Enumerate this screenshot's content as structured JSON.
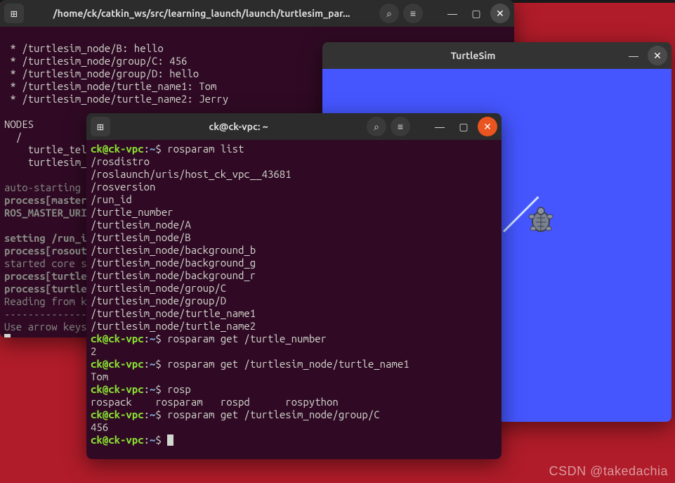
{
  "watermark": "CSDN @takedachia",
  "win1": {
    "title": "/home/ck/catkin_ws/src/learning_launch/launch/turtlesim_par...",
    "lines": [
      " * /turtlesim_node/B: hello",
      " * /turtlesim_node/group/C: 456",
      " * /turtlesim_node/group/D: hello",
      " * /turtlesim_node/turtle_name1: Tom",
      " * /turtlesim_node/turtle_name2: Jerry",
      "",
      "NODES",
      "  /",
      "    turtle_tel",
      "    turtlesim_"
    ],
    "dimlines": [
      "",
      "auto-starting ",
      "process[master",
      "ROS_MASTER_URI",
      "",
      "setting /run_i",
      "process[rosout",
      "started core s",
      "process[turtle",
      "process[turtle",
      "Reading from k",
      "--------------",
      "Use arrow keys"
    ]
  },
  "win2": {
    "title": "ck@ck-vpc: ~",
    "prompt_user": "ck@ck-vpc",
    "prompt_path": "~",
    "prompt_sep": ":",
    "prompt_end": "$ ",
    "cmd1": "rosparam list",
    "out1": [
      "/rosdistro",
      "/roslaunch/uris/host_ck_vpc__43681",
      "/rosversion",
      "/run_id",
      "/turtle_number",
      "/turtlesim_node/A",
      "/turtlesim_node/B",
      "/turtlesim_node/background_b",
      "/turtlesim_node/background_g",
      "/turtlesim_node/background_r",
      "/turtlesim_node/group/C",
      "/turtlesim_node/group/D",
      "/turtlesim_node/turtle_name1",
      "/turtlesim_node/turtle_name2"
    ],
    "cmd2": "rosparam get /turtle_number",
    "out2": "2",
    "cmd3": "rosparam get /turtlesim_node/turtle_name1",
    "out3": "Tom",
    "cmd4": "rosp",
    "out4": "rospack    rosparam   rospd      rospython  ",
    "cmd5": "rosparam get /turtlesim_node/group/C",
    "out5": "456"
  },
  "win3": {
    "title": "TurtleSim"
  },
  "icons": {
    "search": "⌕",
    "menu": "≡",
    "min": "—",
    "max": "▢",
    "close": "✕",
    "newtab": "⊞"
  }
}
